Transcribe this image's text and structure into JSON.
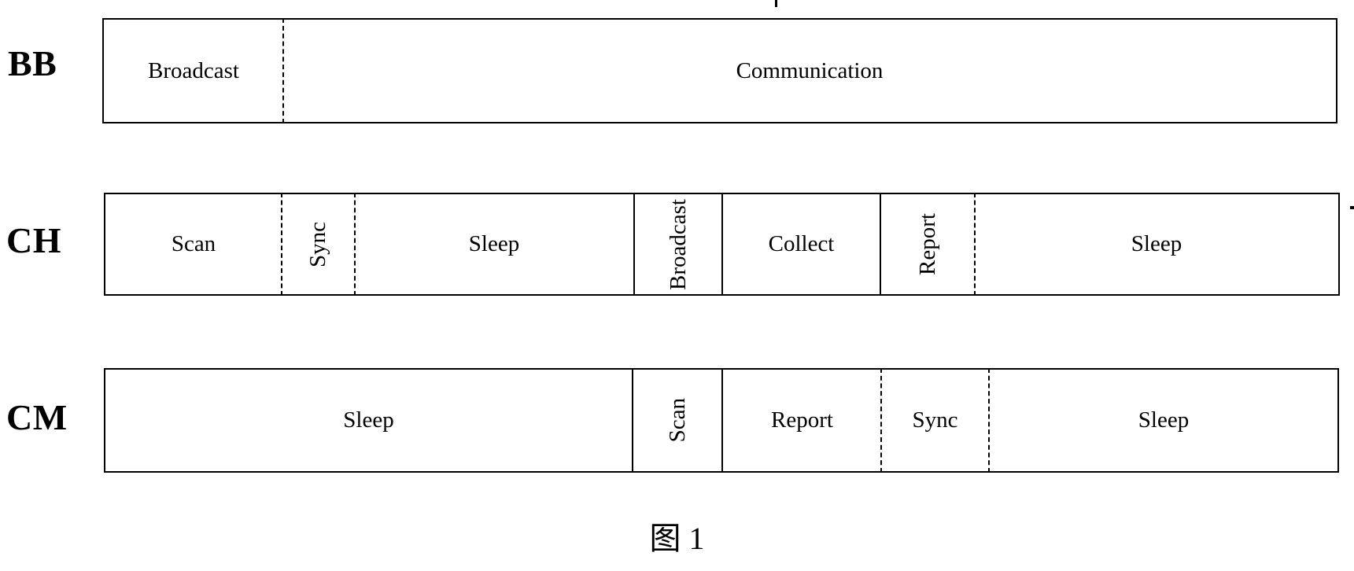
{
  "figure": {
    "caption": "图 1",
    "background_color": "#ffffff",
    "line_color": "#000000"
  },
  "rows": [
    {
      "label": "BB",
      "segments": [
        {
          "text": "Broadcast",
          "orientation": "horizontal",
          "divider": "dashed"
        },
        {
          "text": "Communication",
          "orientation": "horizontal",
          "divider": "none"
        }
      ]
    },
    {
      "label": "CH",
      "segments": [
        {
          "text": "Scan",
          "orientation": "horizontal",
          "divider": "dashed"
        },
        {
          "text": "Sync",
          "orientation": "vertical",
          "divider": "dashed"
        },
        {
          "text": "Sleep",
          "orientation": "horizontal",
          "divider": "solid"
        },
        {
          "text": "Broadcast",
          "orientation": "vertical",
          "divider": "solid"
        },
        {
          "text": "Collect",
          "orientation": "horizontal",
          "divider": "solid"
        },
        {
          "text": "Report",
          "orientation": "vertical",
          "divider": "dashed"
        },
        {
          "text": "Sleep",
          "orientation": "horizontal",
          "divider": "none"
        }
      ]
    },
    {
      "label": "CM",
      "segments": [
        {
          "text": "Sleep",
          "orientation": "horizontal",
          "divider": "solid"
        },
        {
          "text": "Scan",
          "orientation": "vertical",
          "divider": "solid"
        },
        {
          "text": "Report",
          "orientation": "horizontal",
          "divider": "dashed"
        },
        {
          "text": "Sync",
          "orientation": "horizontal",
          "divider": "dashed"
        },
        {
          "text": "Sleep",
          "orientation": "horizontal",
          "divider": "none"
        }
      ]
    }
  ]
}
